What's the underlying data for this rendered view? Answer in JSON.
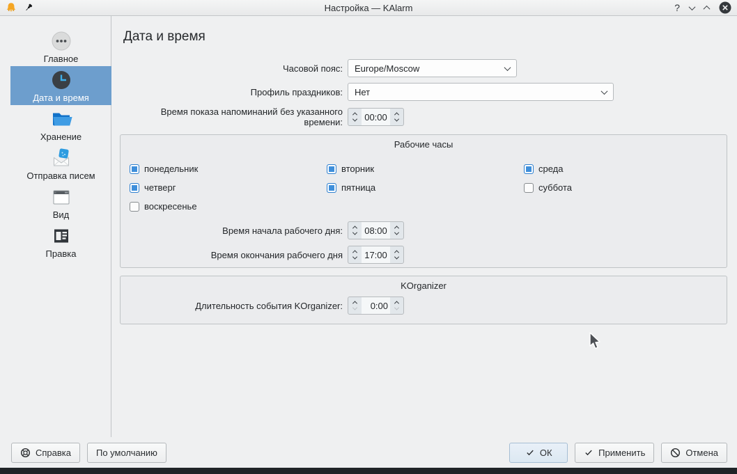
{
  "titlebar": {
    "title": "Настройка — KAlarm",
    "help_label": "?"
  },
  "sidebar": {
    "items": [
      {
        "label": "Главное",
        "icon": "overview-icon",
        "selected": false
      },
      {
        "label": "Дата и время",
        "icon": "clock-icon",
        "selected": true
      },
      {
        "label": "Хранение",
        "icon": "folder-icon",
        "selected": false
      },
      {
        "label": "Отправка писем",
        "icon": "mail-send-icon",
        "selected": false
      },
      {
        "label": "Вид",
        "icon": "window-view-icon",
        "selected": false
      },
      {
        "label": "Правка",
        "icon": "editor-icon",
        "selected": false
      }
    ]
  },
  "page": {
    "heading": "Дата и время",
    "timezone": {
      "label": "Часовой пояс:",
      "value": "Europe/Moscow"
    },
    "holiday_profile": {
      "label": "Профиль праздников:",
      "value": "Нет"
    },
    "default_reminder_time": {
      "label": "Время показа напоминаний без указанного времени:",
      "value": "00:00"
    },
    "working_hours": {
      "title": "Рабочие часы",
      "days": [
        {
          "label": "понедельник",
          "checked": true
        },
        {
          "label": "вторник",
          "checked": true
        },
        {
          "label": "среда",
          "checked": true
        },
        {
          "label": "четверг",
          "checked": true
        },
        {
          "label": "пятница",
          "checked": true
        },
        {
          "label": "суббота",
          "checked": false
        },
        {
          "label": "воскресенье",
          "checked": false
        }
      ],
      "start_time": {
        "label": "Время начала рабочего дня:",
        "value": "08:00"
      },
      "end_time": {
        "label": "Время окончания рабочего дня",
        "value": "17:00"
      }
    },
    "korganizer": {
      "title": "KOrganizer",
      "event_duration": {
        "label": "Длительность события KOrganizer:",
        "value": "0:00"
      }
    }
  },
  "footer": {
    "help": "Справка",
    "defaults": "По умолчанию",
    "ok": "ОК",
    "apply": "Применить",
    "cancel": "Отмена"
  },
  "colors": {
    "window_bg": "#eff0f1",
    "sidebar_selection": "#6d9ecd",
    "checkbox_checked": "#3f8fdb",
    "titlebar_bell": "#f5a623"
  }
}
